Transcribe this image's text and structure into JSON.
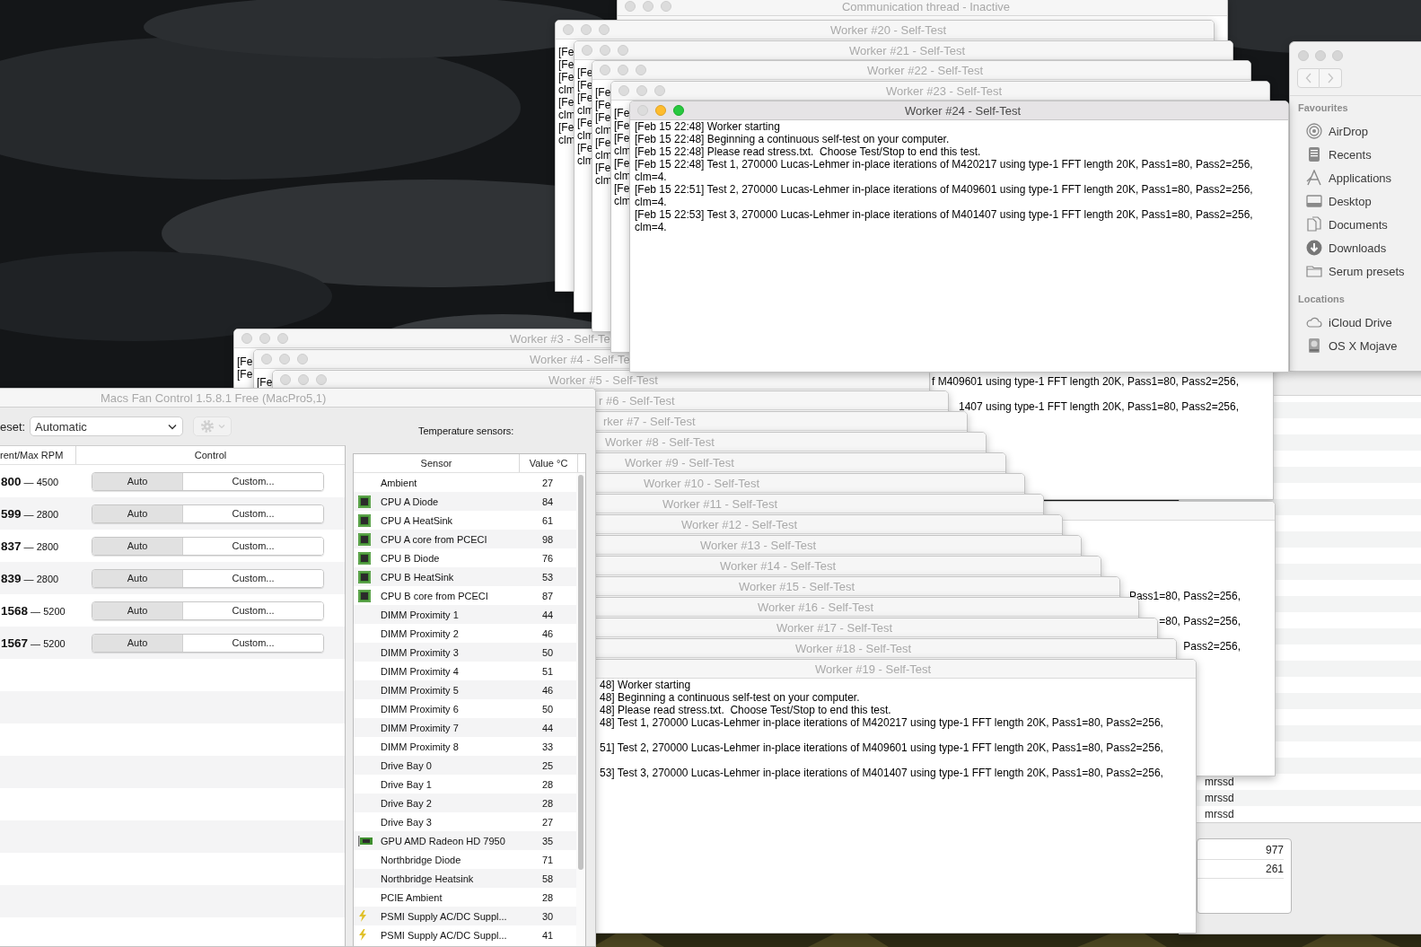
{
  "process_window": {
    "users": [
      "mrssd",
      "mrssd",
      "mrssd"
    ],
    "stats": [
      "977",
      "261"
    ]
  },
  "finder": {
    "sections": [
      {
        "heading": "Favourites",
        "items": [
          {
            "label": "AirDrop",
            "kind": "airdrop"
          },
          {
            "label": "Recents",
            "kind": "recents"
          },
          {
            "label": "Applications",
            "kind": "applications"
          },
          {
            "label": "Desktop",
            "kind": "desktop"
          },
          {
            "label": "Documents",
            "kind": "documents"
          },
          {
            "label": "Downloads",
            "kind": "downloads"
          },
          {
            "label": "Serum presets",
            "kind": "folder"
          }
        ]
      },
      {
        "heading": "Locations",
        "items": [
          {
            "label": "iCloud Drive",
            "kind": "cloud"
          },
          {
            "label": "OS X Mojave",
            "kind": "disk"
          }
        ]
      }
    ]
  },
  "communication_window": {
    "title": "Communication thread - Inactive"
  },
  "background_logs": [
    {
      "lines": [
        "f M409601 using type-1 FFT length 20K, Pass1=80, Pass2=256,",
        "1407 using type-1 FFT length 20K, Pass1=80, Pass2=256,"
      ]
    },
    {
      "lines": [
        "Pass1=80, Pass2=256,",
        "=80, Pass2=256,",
        "Pass2=256,"
      ]
    }
  ],
  "lower_workers": [
    {
      "title": "Worker #3 - Self-Te",
      "active": false,
      "lines": [
        "[Fe",
        "[Fe"
      ]
    },
    {
      "title": "Worker #4 - Self-Te",
      "active": false,
      "lines": [
        "[Fe"
      ]
    },
    {
      "title": "Worker #5 - Self-Test",
      "active": false
    },
    {
      "title": "r #6 - Self-Test",
      "active": false
    },
    {
      "title": "rker #7 - Self-Test",
      "active": false
    },
    {
      "title": "Worker #8 - Self-Test",
      "active": false
    },
    {
      "title": "Worker #9 - Self-Test",
      "active": false
    },
    {
      "title": "Worker #10 - Self-Test",
      "active": false
    },
    {
      "title": "Worker #11 - Self-Test",
      "active": false
    },
    {
      "title": "Worker #12 - Self-Test",
      "active": false
    },
    {
      "title": "Worker #13 - Self-Test",
      "active": false
    },
    {
      "title": "Worker #14 - Self-Test",
      "active": false
    },
    {
      "title": "Worker #15 - Self-Test",
      "active": false
    },
    {
      "title": "Worker #16 - Self-Test",
      "active": false
    },
    {
      "title": "Worker #17 - Self-Test",
      "active": false
    },
    {
      "title": "Worker #18 - Self-Test",
      "active": false
    },
    {
      "title": "Worker #19 - Self-Test",
      "active": false,
      "lines": [
        "48] Worker starting",
        "48] Beginning a continuous self-test on your computer.",
        "48] Please read stress.txt.  Choose Test/Stop to end this test.",
        "48] Test 1, 270000 Lucas-Lehmer in-place iterations of M420217 using type-1 FFT length 20K, Pass1=80, Pass2=256,",
        "51] Test 2, 270000 Lucas-Lehmer in-place iterations of M409601 using type-1 FFT length 20K, Pass1=80, Pass2=256,",
        "53] Test 3, 270000 Lucas-Lehmer in-place iterations of M401407 using type-1 FFT length 20K, Pass1=80, Pass2=256,"
      ]
    }
  ],
  "upper_workers": [
    {
      "title": "Worker #20 - Self-Test",
      "active": false,
      "lines": [
        "[Fe",
        "[Fe",
        "[Fe",
        "clm",
        "[Fe",
        "clm",
        "[Fe",
        "clm"
      ]
    },
    {
      "title": "Worker #21 - Self-Test",
      "active": false,
      "lines": [
        "[Fe",
        "[Fe",
        "[Fe",
        "clm",
        "[Fe",
        "clm",
        "[Fe",
        "clm"
      ]
    },
    {
      "title": "Worker #22 - Self-Test",
      "active": false,
      "lines": [
        "[Fe",
        "[Fe",
        "[Fe",
        "clm",
        "[Fe",
        "clm",
        "[Fe",
        "clm"
      ]
    },
    {
      "title": "Worker #23 - Self-Test",
      "active": false,
      "lines": [
        "[Fe",
        "[Fe",
        "[Fe",
        "clm",
        "[Fe",
        "clm",
        "[Fe",
        "clm"
      ]
    },
    {
      "title": "Worker #24 - Self-Test",
      "active": true,
      "lines": [
        "[Feb 15 22:48] Worker starting",
        "[Feb 15 22:48] Beginning a continuous self-test on your computer.",
        "[Feb 15 22:48] Please read stress.txt.  Choose Test/Stop to end this test.",
        "[Feb 15 22:48] Test 1, 270000 Lucas-Lehmer in-place iterations of M420217 using type-1 FFT length 20K, Pass1=80, Pass2=256,",
        "clm=4.",
        "[Feb 15 22:51] Test 2, 270000 Lucas-Lehmer in-place iterations of M409601 using type-1 FFT length 20K, Pass1=80, Pass2=256,",
        "clm=4.",
        "[Feb 15 22:53] Test 3, 270000 Lucas-Lehmer in-place iterations of M401407 using type-1 FFT length 20K, Pass1=80, Pass2=256,",
        "clm=4."
      ]
    }
  ],
  "fan_control": {
    "title": "Macs Fan Control 1.5.8.1 Free (MacPro5,1)",
    "preset_label": "eset:",
    "preset": "Automatic",
    "fan_columns": [
      "rent/Max RPM",
      "Control"
    ],
    "fans": [
      {
        "rpm": "**800** — 4500",
        "modes": [
          {
            "label": "Auto",
            "selected": true
          },
          {
            "label": "Custom...",
            "selected": false
          }
        ]
      },
      {
        "rpm": "**599** — 2800",
        "modes": [
          {
            "label": "Auto",
            "selected": true
          },
          {
            "label": "Custom...",
            "selected": false
          }
        ]
      },
      {
        "rpm": "**837** — 2800",
        "modes": [
          {
            "label": "Auto",
            "selected": true
          },
          {
            "label": "Custom...",
            "selected": false
          }
        ]
      },
      {
        "rpm": "**839** — 2800",
        "modes": [
          {
            "label": "Auto",
            "selected": true
          },
          {
            "label": "Custom...",
            "selected": false
          }
        ]
      },
      {
        "rpm": "**1568** — 5200",
        "modes": [
          {
            "label": "Auto",
            "selected": true
          },
          {
            "label": "Custom...",
            "selected": false
          }
        ]
      },
      {
        "rpm": "**1567** — 5200",
        "modes": [
          {
            "label": "Auto",
            "selected": true
          },
          {
            "label": "Custom...",
            "selected": false
          }
        ]
      }
    ],
    "sensors_label": "Temperature sensors:",
    "sensor_columns": [
      "Sensor",
      "Value °C"
    ],
    "sensors": [
      {
        "name": "Ambient",
        "value": "27"
      },
      {
        "name": "CPU A Diode",
        "value": "84",
        "kind": "cpu"
      },
      {
        "name": "CPU A HeatSink",
        "value": "61",
        "kind": "cpu"
      },
      {
        "name": "CPU A core from PCECI",
        "value": "98",
        "kind": "cpu"
      },
      {
        "name": "CPU B Diode",
        "value": "76",
        "kind": "cpu"
      },
      {
        "name": "CPU B HeatSink",
        "value": "53",
        "kind": "cpu"
      },
      {
        "name": "CPU B core from PCECI",
        "value": "87",
        "kind": "cpu"
      },
      {
        "name": "DIMM Proximity 1",
        "value": "44"
      },
      {
        "name": "DIMM Proximity 2",
        "value": "46"
      },
      {
        "name": "DIMM Proximity 3",
        "value": "50"
      },
      {
        "name": "DIMM Proximity 4",
        "value": "51"
      },
      {
        "name": "DIMM Proximity 5",
        "value": "46"
      },
      {
        "name": "DIMM Proximity 6",
        "value": "50"
      },
      {
        "name": "DIMM Proximity 7",
        "value": "44"
      },
      {
        "name": "DIMM Proximity 8",
        "value": "33"
      },
      {
        "name": "Drive Bay 0",
        "value": "25"
      },
      {
        "name": "Drive Bay 1",
        "value": "28"
      },
      {
        "name": "Drive Bay 2",
        "value": "28"
      },
      {
        "name": "Drive Bay 3",
        "value": "27"
      },
      {
        "name": "GPU AMD Radeon HD 7950",
        "value": "35",
        "kind": "gpu"
      },
      {
        "name": "Northbridge Diode",
        "value": "71"
      },
      {
        "name": "Northbridge Heatsink",
        "value": "58"
      },
      {
        "name": "PCIE Ambient",
        "value": "28"
      },
      {
        "name": "PSMI Supply AC/DC Suppl...",
        "value": "30",
        "kind": "power"
      },
      {
        "name": "PSMI Supply AC/DC Suppl...",
        "value": "41",
        "kind": "power"
      }
    ]
  }
}
